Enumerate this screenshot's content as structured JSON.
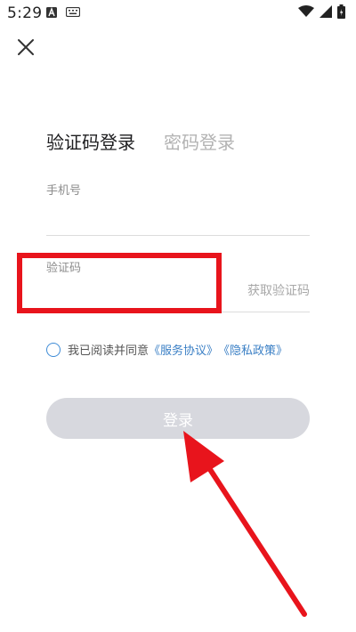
{
  "status_bar": {
    "time": "5:29"
  },
  "tabs": [
    {
      "label": "验证码登录",
      "active": true
    },
    {
      "label": "密码登录",
      "active": false
    }
  ],
  "phone_field": {
    "label": "手机号",
    "value": "",
    "placeholder": ""
  },
  "code_field": {
    "label": "验证码",
    "value": "",
    "placeholder": "",
    "get_code_label": "获取验证码"
  },
  "agreement": {
    "prefix": "我已阅读并同意",
    "service_link": "《服务协议》",
    "privacy_link": "《隐私政策》",
    "checked": false
  },
  "login_button": {
    "label": "登录"
  },
  "colors": {
    "accent": "#3a7fc5",
    "highlight": "#e8141c",
    "button_bg": "#d7d8de"
  },
  "icons": [
    "close-icon",
    "notification-a-icon",
    "keyboard-icon",
    "wifi-icon",
    "signal-icon",
    "battery-icon",
    "radio-unchecked-icon"
  ]
}
